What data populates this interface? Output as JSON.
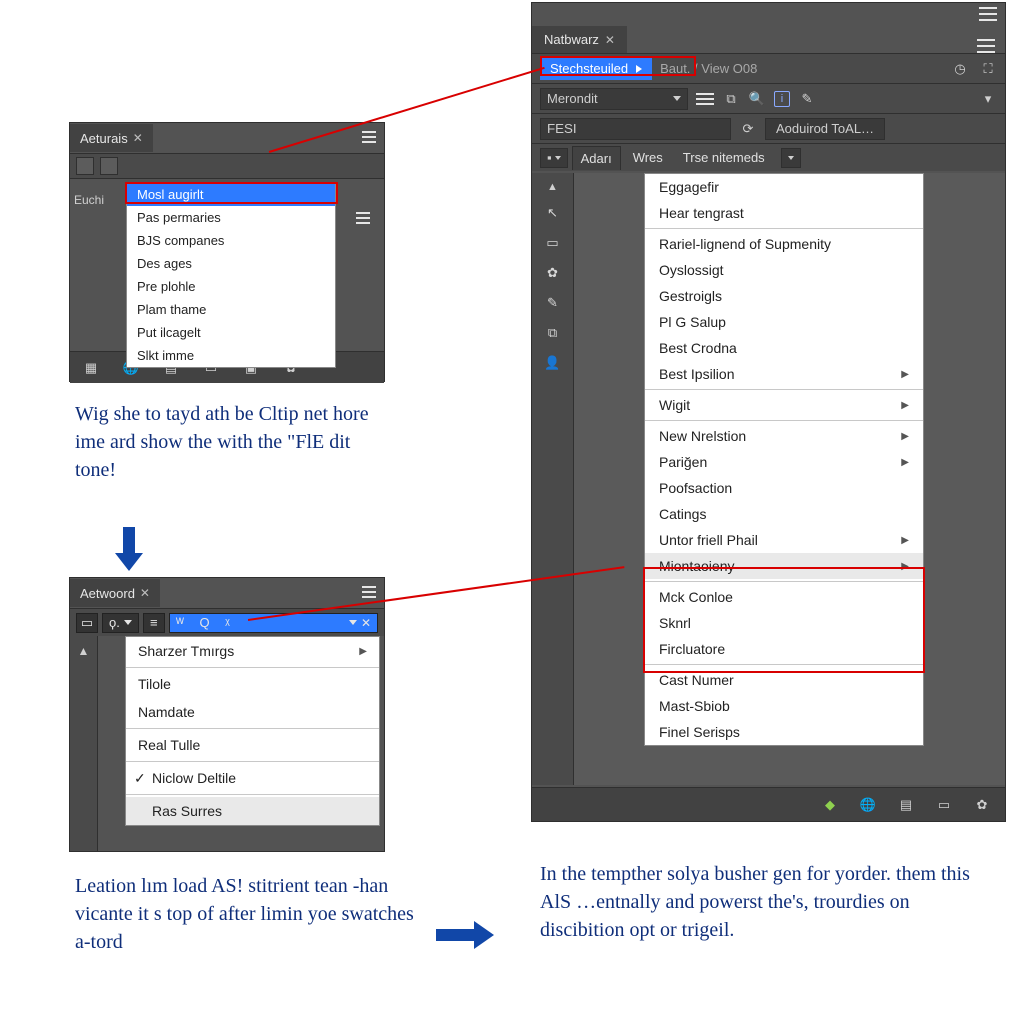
{
  "panel1": {
    "tab_title": "Aeturais",
    "left_label": "Euchi",
    "dropdown": [
      "Mosl augirlt",
      "Pas permaries",
      "BJS companes",
      "Des ages",
      "Pre plohle",
      "Plam thame",
      "Put ilcagelt",
      "Slkt imme"
    ],
    "bottom_icons": [
      "swatches",
      "globe",
      "grid",
      "page",
      "box9",
      "gear"
    ]
  },
  "caption1": "Wig she to tayd ath be Cltip net hore ime ard show the with the \"FlE dit tone!",
  "panel2": {
    "tab_title": "Aetwoord",
    "toolbar_glyph": "ϙ.",
    "toolbar_blue_glyphs": "ᵂ  Q  ᵡ",
    "dropdown": {
      "items": [
        {
          "label": "Sharzer Tmırgs",
          "sub": true
        },
        {
          "label": "Tilole"
        },
        {
          "label": "Namdate"
        },
        {
          "label": "Real Tulle"
        },
        {
          "label": "Niclow Deltile",
          "checked": true
        },
        {
          "label": "Ras Surres",
          "selected": true
        }
      ]
    }
  },
  "caption2": "Leation lım load AS! stitrient tean -han vicante it s top of after limin yoe swatches a-tord",
  "caption3": "In the tempther solya busher gen for yorder. them this AlS …entnally and powerst the's, trourdies on discibition opt or trigeil.",
  "panel3": {
    "tab_title": "Natbwarz",
    "breadcrumb_main": "Stechsteuiled",
    "breadcrumb_rest": "Baut. / View O08",
    "right_corner_icons": [
      "clock",
      "expand"
    ],
    "select_value": "Merondit",
    "toolbar_icons": [
      "hamburger",
      "plus-doc",
      "search",
      "info",
      "pencil"
    ],
    "search_value": "FESI",
    "search_right_icon": "refresh",
    "action_button": "Aoduirod ToAL…",
    "mini_tabs": [
      "Adarı",
      "Wres",
      "Trse nitemeds"
    ],
    "sidebar_icons": [
      "caret-up",
      "cursor",
      "page",
      "gear-sm",
      "pencil",
      "double-page",
      "user"
    ],
    "dropdown": [
      {
        "label": "Eggagefir"
      },
      {
        "label": "Hear tengrast"
      },
      {
        "sep": true
      },
      {
        "label": "Rariel-lignend of Supmenity"
      },
      {
        "label": "Oyslossigt"
      },
      {
        "label": "Gestroigls"
      },
      {
        "label": "Pl G Salup"
      },
      {
        "label": "Best Crodna"
      },
      {
        "label": "Best Ipsilion",
        "sub": true
      },
      {
        "sep": true
      },
      {
        "label": "Wigit",
        "sub": true
      },
      {
        "sep": true
      },
      {
        "label": "New Nrelstion",
        "sub": true
      },
      {
        "label": "Pariğen",
        "sub": true
      },
      {
        "label": "Poofsaction"
      },
      {
        "label": "Catings"
      },
      {
        "label": "Untor friell Phail",
        "sub": true
      },
      {
        "label": "Miontaoieny",
        "sub": true,
        "selected": true
      },
      {
        "sep": true
      },
      {
        "label": "Mck Conloe"
      },
      {
        "label": "Sknrl"
      },
      {
        "label": "Fircluatore"
      },
      {
        "sep": true
      },
      {
        "label": "Cast Numer"
      },
      {
        "label": "Mast-Sbiob"
      },
      {
        "label": "Finel Serisps"
      }
    ],
    "bottom_icons": [
      "swatch",
      "globe",
      "grid",
      "page",
      "gear"
    ]
  }
}
